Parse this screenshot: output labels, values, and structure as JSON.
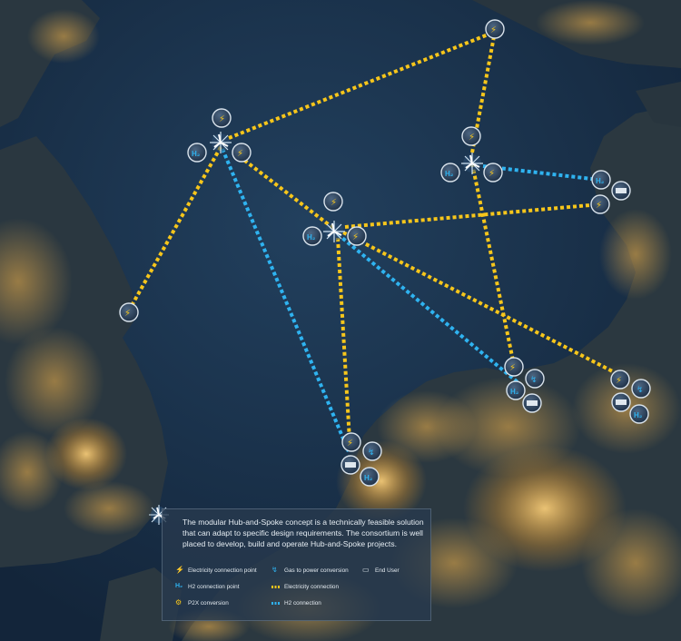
{
  "legend": {
    "description": "The modular Hub-and-Spoke concept is a technically feasible solution that can adapt to specific design requirements. The consortium is well placed to develop, build and operate Hub-and-Spoke projects.",
    "items": [
      {
        "symbol": "electricity-connection-point-icon",
        "label": "Electricity connection point"
      },
      {
        "symbol": "gas-to-power-icon",
        "label": "Gas to power conversion"
      },
      {
        "symbol": "end-user-icon",
        "label": "End User"
      },
      {
        "symbol": "h2-connection-point-icon",
        "label": "H2 connection point"
      },
      {
        "symbol": "electricity-connection-line",
        "label": "Electricity connection"
      },
      {
        "symbol": "p2x-conversion-icon",
        "label": "P2X conversion"
      },
      {
        "symbol": "h2-connection-line",
        "label": "H2 connection"
      }
    ]
  },
  "colors": {
    "electricity": "#f7c61b",
    "h2": "#2fb3f0",
    "sea": "#1b3048",
    "land": "#26333b",
    "city_light": "#f2b34a"
  },
  "hub_labels": {
    "h2": "H₂"
  }
}
